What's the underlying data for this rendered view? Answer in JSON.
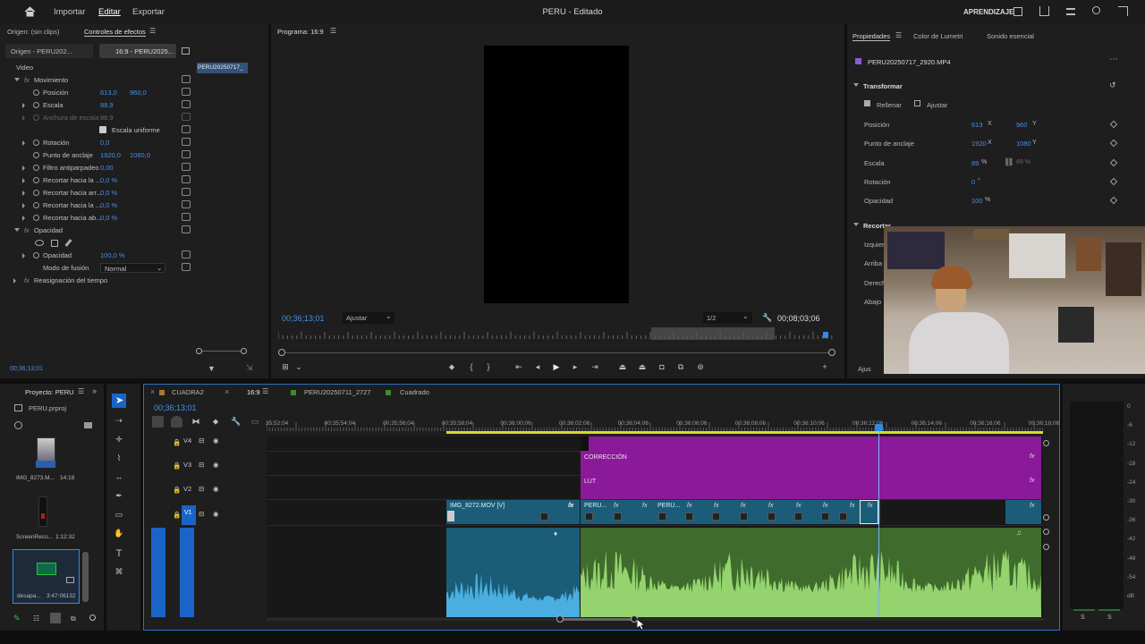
{
  "topbar": {
    "home_icon": "home-icon",
    "menu": [
      "Importar",
      "Editar",
      "Exportar"
    ],
    "title": "PERU - Editado",
    "workspace": "APRENDIZAJE"
  },
  "effect_controls": {
    "tabs": [
      "Origen: (sin clips)",
      "Controles de efectos"
    ],
    "source_tabs": [
      "Origen - PERU202...",
      "16:9 - PERU2025..."
    ],
    "clip_name": "PERU20250717_",
    "section_video": "Video",
    "motion": {
      "label": "Movimiento",
      "position": {
        "label": "Posición",
        "x": "613,0",
        "y": "960,0"
      },
      "scale": {
        "label": "Escala",
        "value": "88,9"
      },
      "scale_width": {
        "label": "Anchura de escala",
        "value": "88,9"
      },
      "uniform_scale": "Escala uniforme",
      "rotation": {
        "label": "Rotación",
        "value": "0,0"
      },
      "anchor": {
        "label": "Punto de anclaje",
        "x": "1920,0",
        "y": "1080,0"
      },
      "flicker": {
        "label": "Filtro antiparpadeo",
        "value": "0,00"
      },
      "crop": [
        {
          "label": "Recortar hacia la ...",
          "value": "0,0 %"
        },
        {
          "label": "Recortar hacia arr...",
          "value": "0,0 %"
        },
        {
          "label": "Recortar hacia la ...",
          "value": "0,0 %"
        },
        {
          "label": "Recortar hacia ab...",
          "value": "0,0 %"
        }
      ]
    },
    "opacity_section": {
      "label": "Opacidad",
      "opacity_label": "Opacidad",
      "opacity_value": "100,0 %",
      "blend_label": "Modo de fusión",
      "blend_value": "Normal"
    },
    "time_remap": "Reasignación del tiempo",
    "timecode": "00;36;13;01"
  },
  "program": {
    "title": "Programa: 16:9",
    "timecode": "00;36;13;01",
    "fit": "Ajustar",
    "resolution": "1/2",
    "duration": "00;08;03;06"
  },
  "properties": {
    "tabs": [
      "Propiedades",
      "Color de Lumetri",
      "Sonido esencial"
    ],
    "clip": "PERU20250717_2920.MP4",
    "transform_label": "Transformar",
    "fill": "Rellenar",
    "fit": "Ajustar",
    "position": {
      "label": "Posición",
      "x": "613",
      "y": "960"
    },
    "anchor": {
      "label": "Punto de anclaje",
      "x": "1920",
      "y": "1080"
    },
    "scale": {
      "label": "Escala",
      "value": "89",
      "value2": "89 %"
    },
    "rotation": {
      "label": "Rotación",
      "value": "0"
    },
    "opacity": {
      "label": "Opacidad",
      "value": "100"
    },
    "crop_label": "Recortar",
    "crop_rows": [
      "Izquier",
      "Arriba",
      "Derech",
      "Abajo"
    ],
    "more": "Ajus",
    "units": {
      "x": "X",
      "y": "Y",
      "pct": "%",
      "deg": "°"
    }
  },
  "project": {
    "title": "Proyecto: PERU",
    "file": "PERU.prproj",
    "items": [
      {
        "name": "IMG_8273.M...",
        "dur": "14:18"
      },
      {
        "name": "ScreenReco...",
        "dur": "1:12:32"
      },
      {
        "name": "desapa...",
        "dur": "3:47:06132"
      }
    ]
  },
  "timeline": {
    "tabs": [
      "CUADRA2",
      "16:9",
      "PERU20250711_2727",
      "Cuadrado"
    ],
    "timecode": "00;36;13;01",
    "ruler": [
      "35;52;04",
      "00;35;54;04",
      "00;35;56;04",
      "00;35;58;04",
      "00;36;00;06",
      "00;36;02;06",
      "00;36;04;06",
      "00;36;06;06",
      "00;36;08;06",
      "00;36;10;06",
      "00;36;12;06",
      "00;36;14;06",
      "00;36;16;06",
      "00;36;18;06"
    ],
    "tracks": [
      "V4",
      "V3",
      "V2",
      "V1"
    ],
    "clips": {
      "v3": "CORRECCIÓN",
      "v2": "LUT",
      "v1a": "IMG_8272.MOV [V]",
      "v1b": "PERU...",
      "v1c": "PERU..."
    },
    "fx": "fx"
  },
  "meter": {
    "scale": [
      "0",
      "-6",
      "-12",
      "-18",
      "-24",
      "-30",
      "-36",
      "-42",
      "-48",
      "-54",
      "dB"
    ],
    "solo": [
      "S",
      "S"
    ]
  },
  "colors": {
    "accent": "#2d8ceb",
    "purple": "#8a1a99",
    "teal": "#1b5d78",
    "green": "#5a9a3a"
  }
}
